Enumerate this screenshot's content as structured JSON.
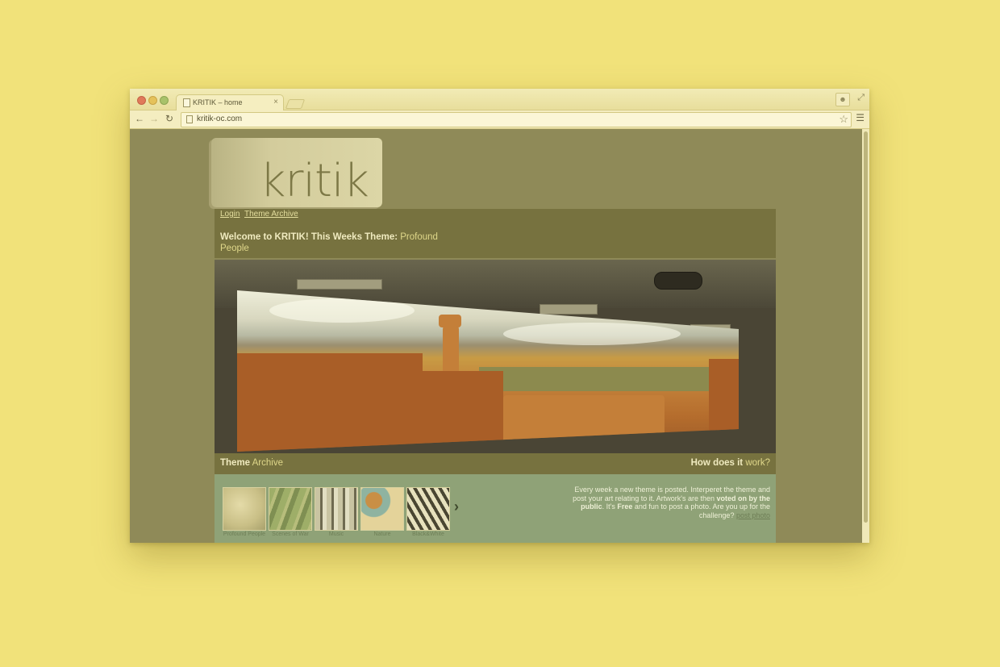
{
  "browser": {
    "tab_title": "KRITIK – home",
    "close_glyph": "×",
    "url": "kritik-oc.com",
    "icons": [
      "back-arrow-icon",
      "forward-arrow-icon",
      "reload-icon",
      "star-icon",
      "menu-icon",
      "user-icon",
      "expand-icon",
      "document-icon"
    ]
  },
  "site": {
    "logo": "kritik",
    "nav": {
      "login": "Login",
      "theme_archive": "Theme Archive"
    },
    "welcome": {
      "prefix": "Welcome to ",
      "brand": "KRITIK",
      "middle": "! This Weeks Theme: ",
      "theme": "Profound People"
    },
    "caption": {
      "left_strong": "Theme",
      "left_rest": " Archive",
      "right_strong": "How does it",
      "right_rest": " work?"
    },
    "thumbnails": [
      {
        "label": "Profound People"
      },
      {
        "label": "Scenes of War"
      },
      {
        "label": "Music"
      },
      {
        "label": "Nature"
      },
      {
        "label": "Black&White"
      }
    ],
    "next_glyph": "›",
    "info": {
      "p1": "Every week a new theme is posted. Interperet the theme and post your art relating to it. Artwork's are then ",
      "b1": "voted on by the public",
      "p2": ". It's ",
      "b2": "Free",
      "p3": " and fun to post a photo. Are you up for the challenge? ",
      "link": "post photo"
    }
  },
  "colors": {
    "page_bg": "#f1e27a",
    "content_bg": "#8f8a58",
    "header_panel": "#77723f",
    "bottom_panel": "#8fa277"
  }
}
